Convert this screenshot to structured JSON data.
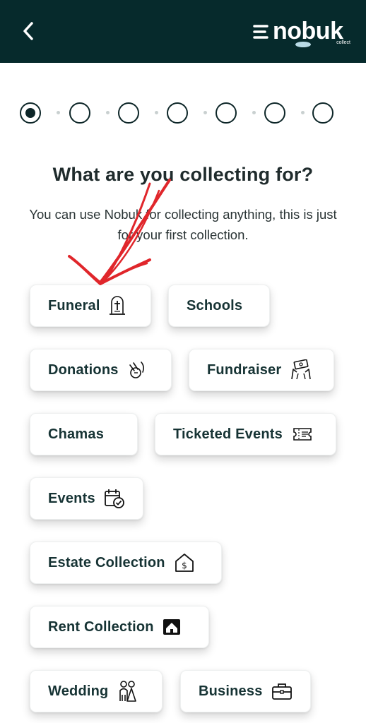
{
  "header": {
    "back_icon": "chevron-left-icon",
    "logo_text": "nobuk",
    "logo_sub": "collect",
    "background": "#062a2c"
  },
  "stepper": {
    "total": 7,
    "current": 1
  },
  "main": {
    "title": "What are you collecting for?",
    "subtitle": "You can use Nobuk for collecting anything, this is just for your first collection."
  },
  "categories": [
    {
      "label": "Funeral",
      "icon": "tombstone-icon"
    },
    {
      "label": "Schools",
      "icon": ""
    },
    {
      "label": "Donations",
      "icon": "donation-hand-icon"
    },
    {
      "label": "Fundraiser",
      "icon": "fundraiser-icon"
    },
    {
      "label": "Chamas",
      "icon": ""
    },
    {
      "label": "Ticketed Events",
      "icon": "ticket-icon"
    },
    {
      "label": "Events",
      "icon": "calendar-check-icon"
    },
    {
      "label": "Estate Collection",
      "icon": "house-dollar-icon"
    },
    {
      "label": "Rent Collection",
      "icon": "rent-house-icon"
    },
    {
      "label": "Wedding",
      "icon": "wedding-couple-icon"
    },
    {
      "label": "Business",
      "icon": "briefcase-icon"
    }
  ],
  "annotation": {
    "color": "#e0262b"
  }
}
